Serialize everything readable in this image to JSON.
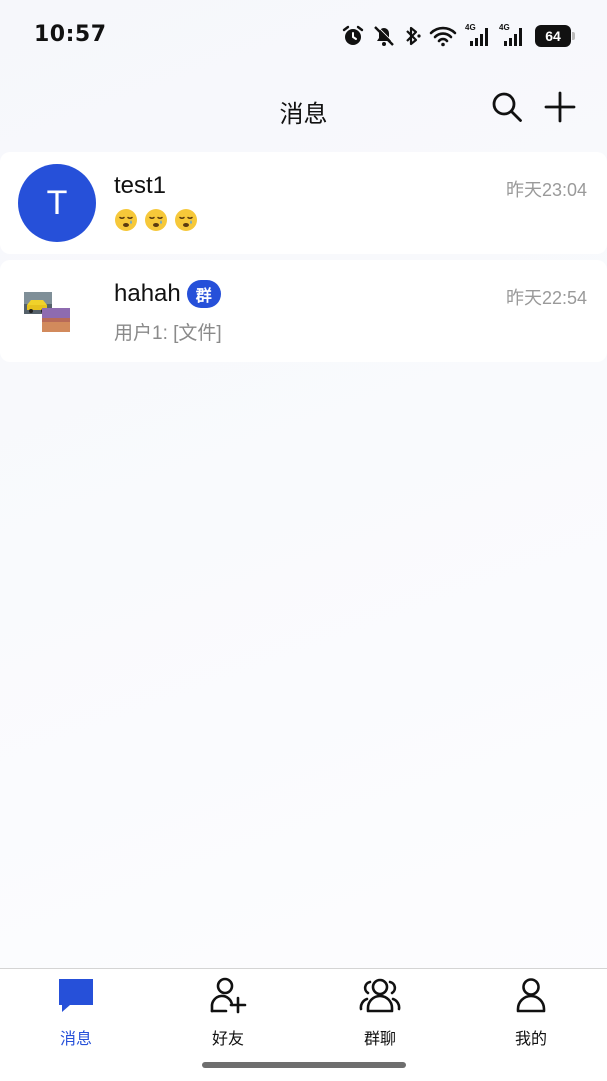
{
  "status_bar": {
    "time": "10:57",
    "network_1": "4G",
    "network_2": "4G",
    "battery": "64",
    "icons": [
      "alarm-icon",
      "mute-bell-icon",
      "bluetooth-icon",
      "wifi-icon",
      "signal-icon",
      "signal-icon",
      "battery-icon"
    ]
  },
  "header": {
    "title": "消息",
    "icons": [
      "search-icon",
      "plus-icon"
    ]
  },
  "conversations": [
    {
      "name": "test1",
      "avatar_letter": "T",
      "time": "昨天23:04",
      "preview_emoji": [
        "😪",
        "😪",
        "😪"
      ]
    },
    {
      "name": "hahah",
      "badge": "群",
      "time": "昨天22:54",
      "preview": "用户1: [文件]"
    }
  ],
  "bottom_nav": {
    "items": [
      {
        "label": "消息",
        "icon": "chat-bubble-icon",
        "active": true
      },
      {
        "label": "好友",
        "icon": "add-friend-icon",
        "active": false
      },
      {
        "label": "群聊",
        "icon": "group-icon",
        "active": false
      },
      {
        "label": "我的",
        "icon": "person-icon",
        "active": false
      }
    ]
  },
  "colors": {
    "accent": "#2650d9",
    "muted_text": "#9a9a9a",
    "background": "#f7f8fc"
  }
}
